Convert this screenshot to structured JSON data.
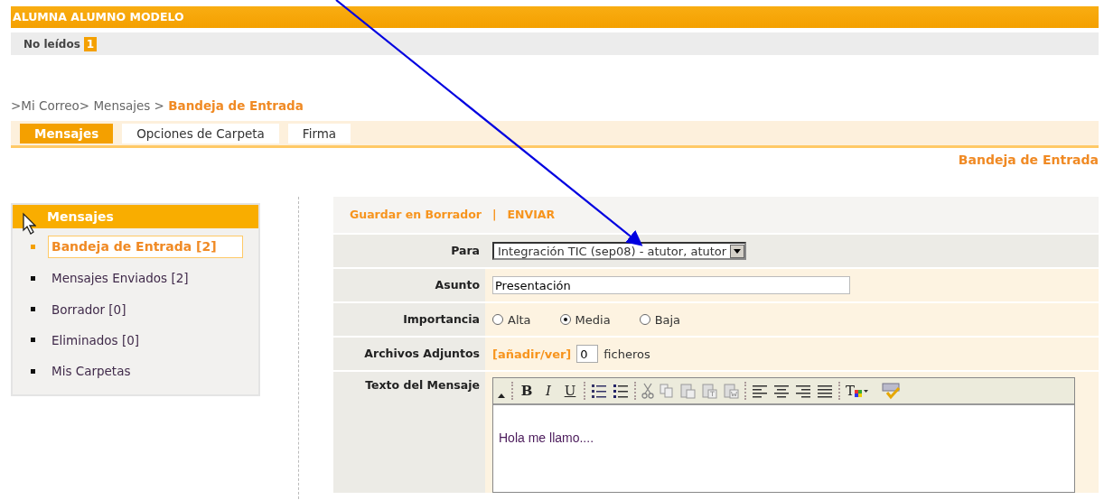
{
  "header": {
    "title": "ALUMNA ALUMNO MODELO"
  },
  "unread": {
    "label": "No leídos",
    "count": "1"
  },
  "breadcrumb": {
    "path": ">Mi Correo> Mensajes >",
    "current": "Bandeja de Entrada"
  },
  "tabs": [
    {
      "label": "Mensajes",
      "selected": true
    },
    {
      "label": "Opciones de Carpeta",
      "selected": false
    },
    {
      "label": "Firma",
      "selected": false
    }
  ],
  "folder_title": "Bandeja de Entrada",
  "sidebar": {
    "title": "Mensajes",
    "items": [
      {
        "label": "Bandeja de Entrada [2]",
        "selected": true
      },
      {
        "label": "Mensajes Enviados [2]",
        "selected": false
      },
      {
        "label": "Borrador [0]",
        "selected": false
      },
      {
        "label": "Eliminados [0]",
        "selected": false
      },
      {
        "label": "Mis Carpetas",
        "selected": false
      }
    ]
  },
  "compose": {
    "actions": [
      "Guardar en Borrador",
      "ENVIAR"
    ],
    "separator": "|",
    "fields": [
      {
        "kind": "select",
        "label": "Para",
        "value": "Integración TIC (sep08) - atutor, atutor"
      },
      {
        "kind": "text",
        "label": "Asunto",
        "value": "Presentación"
      },
      {
        "kind": "radio",
        "label": "Importancia",
        "options": [
          {
            "label": "Alta",
            "selected": false
          },
          {
            "label": "Media",
            "selected": true
          },
          {
            "label": "Baja",
            "selected": false
          }
        ]
      },
      {
        "kind": "attachments",
        "label": "Archivos Adjuntos",
        "link": "[añadir/ver]",
        "value": "0",
        "suffix": "ficheros"
      },
      {
        "kind": "editor",
        "label": "Texto del Mensaje",
        "body": "Hola me llamo...."
      }
    ]
  },
  "editor_toolbar": [
    {
      "kind": "collapse"
    },
    {
      "kind": "sep"
    },
    {
      "kind": "bold",
      "label": "B"
    },
    {
      "kind": "italic",
      "label": "I"
    },
    {
      "kind": "underline",
      "label": "U"
    },
    {
      "kind": "sep"
    },
    {
      "kind": "ordered-list"
    },
    {
      "kind": "bullet-list"
    },
    {
      "kind": "sep"
    },
    {
      "kind": "cut"
    },
    {
      "kind": "copy"
    },
    {
      "kind": "paste"
    },
    {
      "kind": "paste-text"
    },
    {
      "kind": "paste-word"
    },
    {
      "kind": "sep"
    },
    {
      "kind": "align-left"
    },
    {
      "kind": "align-center"
    },
    {
      "kind": "align-right"
    },
    {
      "kind": "justify"
    },
    {
      "kind": "sep"
    },
    {
      "kind": "text-color",
      "label": "T"
    },
    {
      "kind": "spellcheck"
    }
  ]
}
